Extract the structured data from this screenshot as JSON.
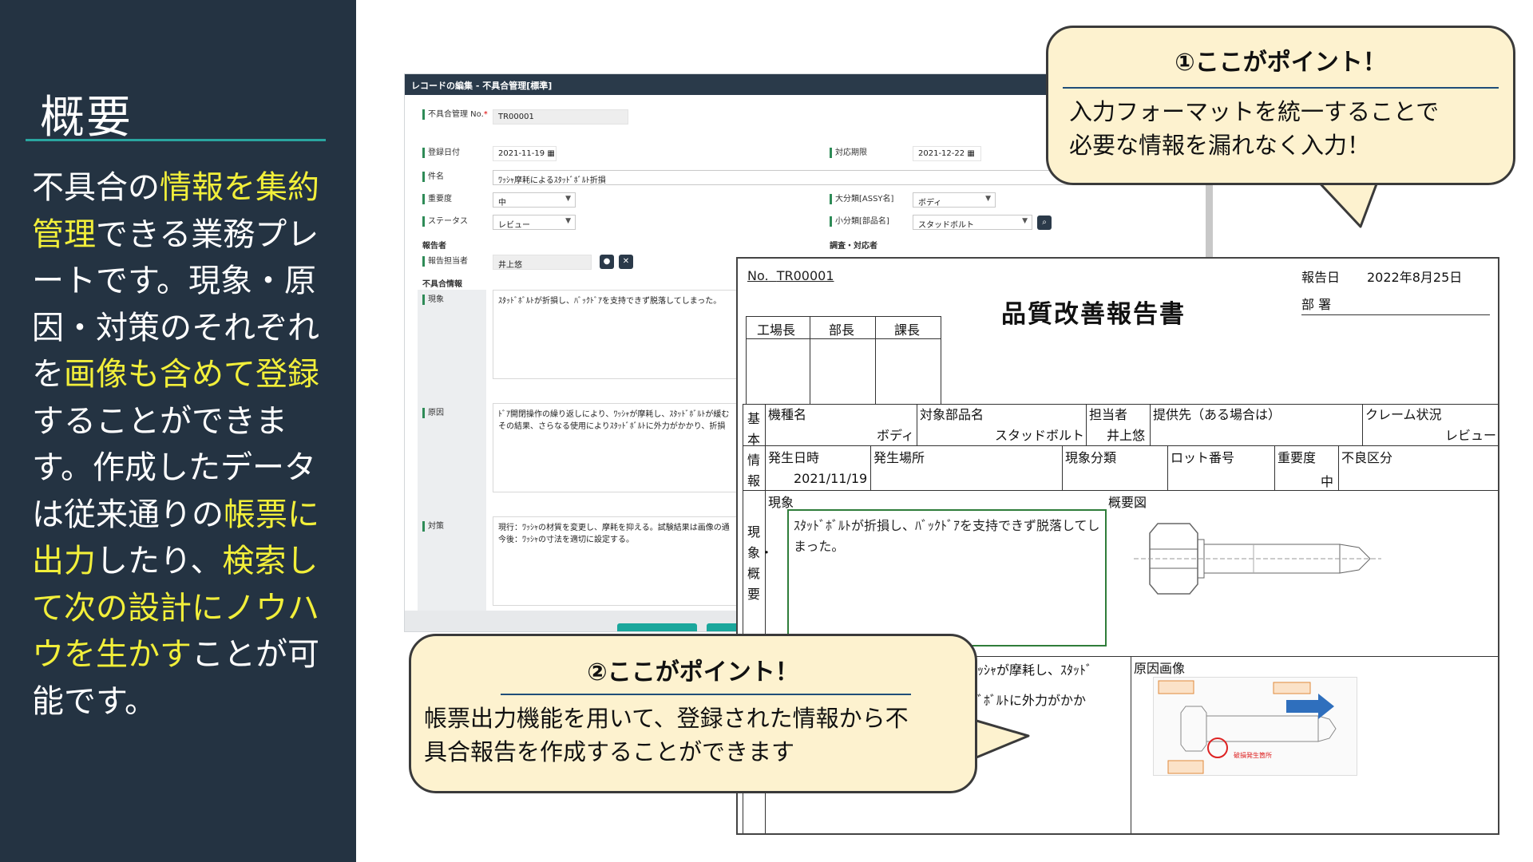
{
  "left": {
    "title": "概要",
    "body_segments": [
      {
        "text": "不具合の",
        "hl": false
      },
      {
        "text": "情報を集約管理",
        "hl": true
      },
      {
        "text": "できる業務プレートです。現象・原因・対策のそれぞれを",
        "hl": false
      },
      {
        "text": "画像も含めて登録",
        "hl": true
      },
      {
        "text": "することができます。作成したデータは従来通りの",
        "hl": false
      },
      {
        "text": "帳票に出力",
        "hl": true
      },
      {
        "text": "したり、",
        "hl": false
      },
      {
        "text": "検索して次の設計にノウハウを生かす",
        "hl": true
      },
      {
        "text": "ことが可能です。",
        "hl": false
      }
    ]
  },
  "editor": {
    "title": "レコードの編集 - 不具合管理[標準]",
    "fields": {
      "no_label": "不具合管理 No.",
      "no_required": "*",
      "no_value": "TR00001",
      "reg_date_label": "登録日付",
      "reg_date_value": "2021-11-19",
      "due_label": "対応期限",
      "due_value": "2021-12-22",
      "subject_label": "件名",
      "subject_value": "ﾜｯｼｬ摩耗によるｽﾀｯﾄﾞﾎﾞﾙﾄ折損",
      "severity_label": "重要度",
      "severity_value": "中",
      "major_label": "大分類[ASSY名]",
      "major_value": "ボディ",
      "status_label": "ステータス",
      "status_value": "レビュー",
      "minor_label": "小分類[部品名]",
      "minor_value": "スタッドボルト",
      "reporter_section": "報告者",
      "investigate_section": "調査・対応者",
      "reporter_label": "報告担当者",
      "reporter_value": "井上悠",
      "info_section": "不具合情報",
      "phenomenon_label": "現象",
      "phenomenon_value": "ｽﾀｯﾄﾞﾎﾞﾙﾄが折損し、ﾊﾞｯｸﾄﾞｱを支持できず脱落してしまった。",
      "cause_label": "原因",
      "cause_value_1": "ﾄﾞｱ開閉操作の繰り返しにより、ﾜｯｼｬが摩耗し、ｽﾀｯﾄﾞﾎﾞﾙﾄが緩む",
      "cause_value_2": "その結果、さらなる使用によりｽﾀｯﾄﾞﾎﾞﾙﾄに外力がかかり、折損",
      "measure_label": "対策",
      "measure_value_1": "現行：ﾜｯｼｬの材質を変更し、摩耗を抑える。試験結果は画像の通",
      "measure_value_2": "今後：ﾜｯｼｬの寸法を適切に設定する。"
    }
  },
  "report": {
    "no_prefix": "No.",
    "no_value": "TR00001",
    "date_label": "報告日",
    "date_value": "2022年8月25日",
    "dept_label": "部 署",
    "title": "品質改善報告書",
    "approvals": [
      "工場長",
      "部長",
      "課長"
    ],
    "basic_info_label": "基本情報",
    "cols1": {
      "model_label": "機種名",
      "model_value": "ボディ",
      "part_label": "対象部品名",
      "part_value": "スタッドボルト",
      "person_label": "担当者",
      "person_value": "井上悠",
      "supplier_label": "提供先（ある場合は）",
      "claim_label": "クレーム状況",
      "claim_value": "レビュー"
    },
    "cols2": {
      "date_label": "発生日時",
      "date_value": "2021/11/19",
      "place_label": "発生場所",
      "class_label": "現象分類",
      "lot_label": "ロット番号",
      "severity_label": "重要度",
      "severity_value": "中",
      "defect_label": "不良区分"
    },
    "phenomenon_side_label": "現象・概要",
    "phenomenon_label": "現象",
    "overview_label": "概要図",
    "phenomenon_text": "ｽﾀｯﾄﾞﾎﾞﾙﾄが折損し、ﾊﾞｯｸﾄﾞｱを支持できず脱落してしまった。",
    "cause_fragment_1": "ｯｼｬが摩耗し、ｽﾀｯﾄﾞ",
    "cause_fragment_2": "ﾞﾎﾞﾙﾄに外力がかか",
    "cause_image_label": "原因画像",
    "cause_image_note": "破損発生箇所"
  },
  "callout1": {
    "title": "①ここがポイント！",
    "line1": "入力フォーマットを統一することで",
    "line2": "必要な情報を漏れなく入力！"
  },
  "callout2": {
    "title": "②ここがポイント！",
    "line1": "帳票出力機能を用いて、登録された情報から不",
    "line2": "具合報告を作成することができます"
  },
  "colors": {
    "panel_bg": "#243342",
    "highlight": "#f2ef3a",
    "accent_rule": "#2aa6a0",
    "callout_bg": "#fdf2cf",
    "callout_rule": "#1f4e79",
    "green_frame": "#2f7d3a"
  }
}
